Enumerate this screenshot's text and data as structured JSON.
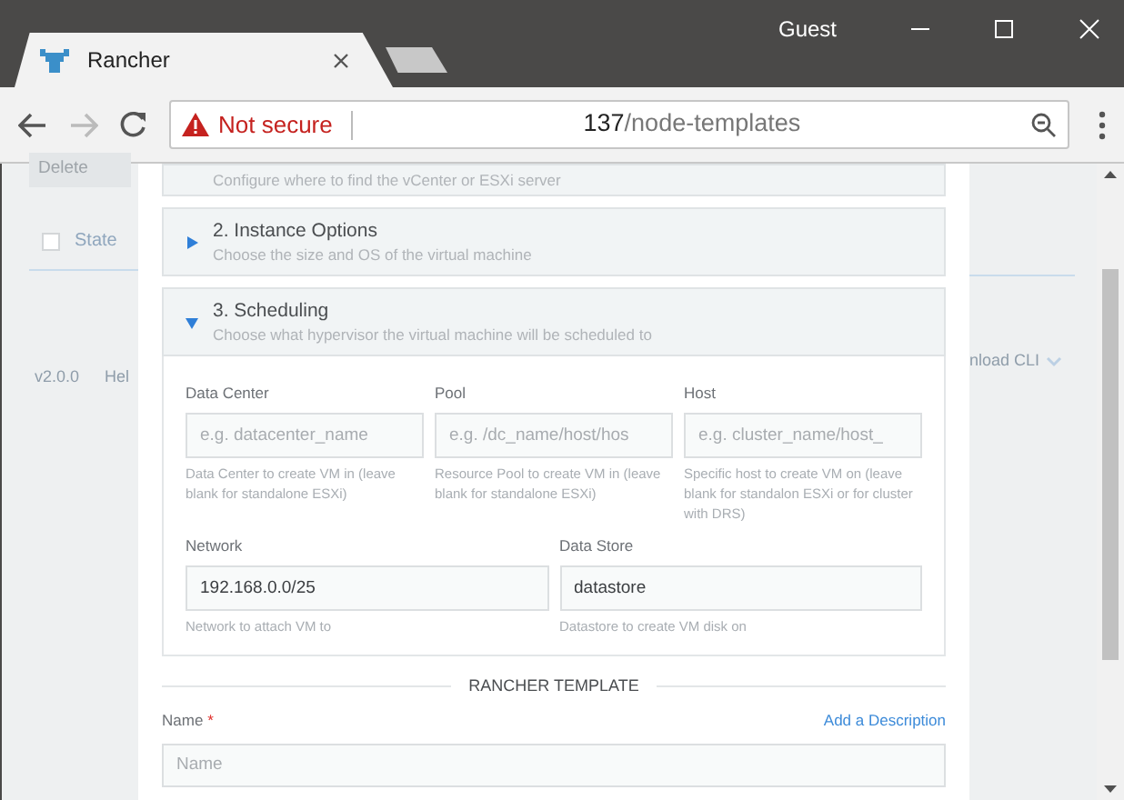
{
  "browser": {
    "tabs": [
      {
        "title": "Rancher",
        "selected": true,
        "kind": "page"
      },
      {
        "selected": false,
        "kind": "new"
      }
    ],
    "profile": "Guest",
    "address": {
      "security": "Not secure",
      "host": "137",
      "path": "/node-templates"
    }
  },
  "background_page": {
    "delete_button": "Delete",
    "select_all_checked": false,
    "state_header": "State",
    "version": "v2.0.0",
    "help": "Hel",
    "download": "nload CLI"
  },
  "sections": [
    {
      "description": "Configure where to find the vCenter or ESXi server"
    },
    {
      "title": "2. Instance Options",
      "description": "Choose the size and OS of the virtual machine",
      "expanded": false
    },
    {
      "title": "3. Scheduling",
      "description": "Choose what hypervisor the virtual machine will be scheduled to",
      "expanded": true,
      "field_rows": [
        [
          {
            "label": "Data Center",
            "placeholder": "e.g. datacenter_name",
            "help": "Data Center to create VM in (leave blank for standalone ESXi)"
          },
          {
            "label": "Pool",
            "placeholder": "e.g. /dc_name/host/hos",
            "help": "Resource Pool to create VM in (leave blank for standalone ESXi)"
          },
          {
            "label": "Host",
            "placeholder": "e.g. cluster_name/host_",
            "help": "Specific host to create VM on (leave blank for standalon ESXi or for cluster with DRS)"
          }
        ],
        [
          {
            "label": "Network",
            "value": "192.168.0.0/25",
            "help": "Network to attach VM to"
          },
          {
            "label": "Data Store",
            "value": "datastore",
            "help": "Datastore to create VM disk on"
          }
        ]
      ]
    }
  ],
  "template": {
    "heading": "RANCHER TEMPLATE",
    "name_label": "Name",
    "required_mark": "*",
    "add_description": "Add a Description",
    "name_placeholder": "Name"
  }
}
